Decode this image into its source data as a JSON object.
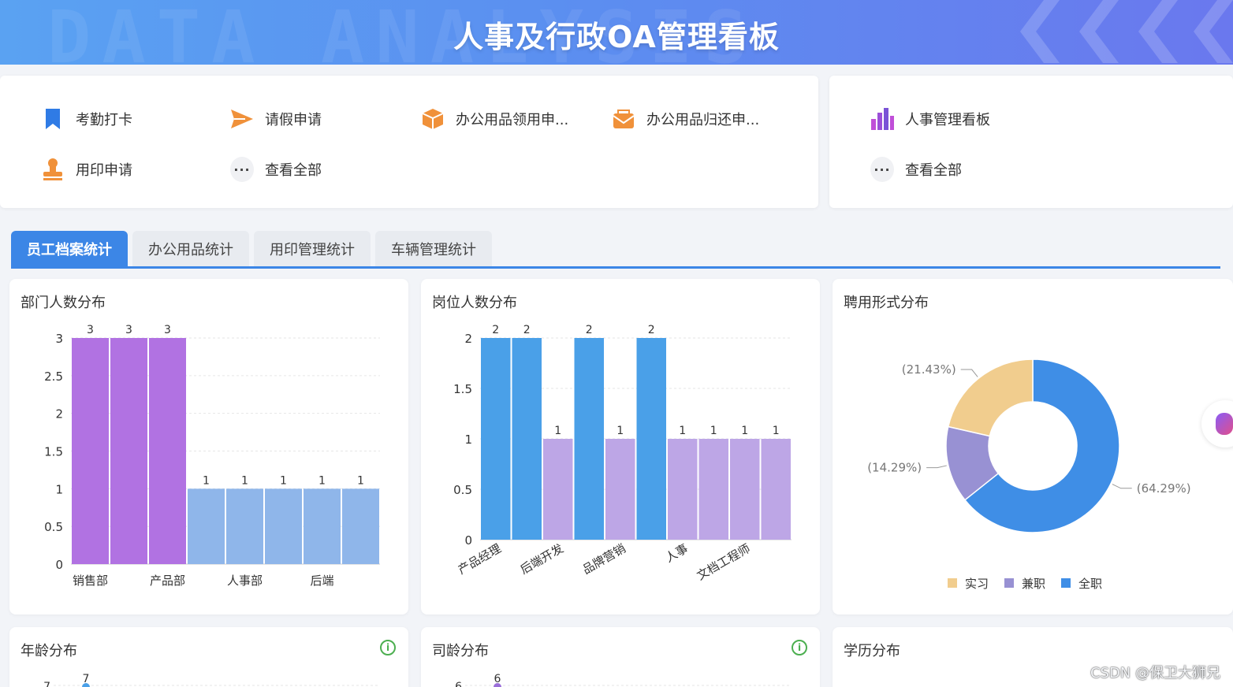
{
  "header": {
    "title": "人事及行政OA管理看板",
    "watermark": "DATA ANALYSIS"
  },
  "quick_left": {
    "items": [
      {
        "label": "考勤打卡",
        "icon": "bookmark-icon",
        "color": "#2f7be5"
      },
      {
        "label": "请假申请",
        "icon": "send-icon",
        "color": "#f0913a"
      },
      {
        "label": "办公用品领用申...",
        "icon": "box-icon",
        "color": "#f0913a"
      },
      {
        "label": "办公用品归还申...",
        "icon": "envelope-icon",
        "color": "#f0913a"
      },
      {
        "label": "用印申请",
        "icon": "stamp-icon",
        "color": "#f0913a"
      },
      {
        "label": "查看全部",
        "icon": "more-icon"
      }
    ]
  },
  "quick_right": {
    "items": [
      {
        "label": "人事管理看板",
        "icon": "bar-chart-icon",
        "color": "#9b4fd8"
      },
      {
        "label": "查看全部",
        "icon": "more-icon"
      }
    ]
  },
  "tabs": [
    {
      "label": "员工档案统计",
      "active": true
    },
    {
      "label": "办公用品统计",
      "active": false
    },
    {
      "label": "用印管理统计",
      "active": false
    },
    {
      "label": "车辆管理统计",
      "active": false
    }
  ],
  "cards": {
    "dept": {
      "title": "部门人数分布"
    },
    "post": {
      "title": "岗位人数分布"
    },
    "hire": {
      "title": "聘用形式分布"
    },
    "age": {
      "title": "年龄分布"
    },
    "tenure": {
      "title": "司龄分布"
    },
    "edu": {
      "title": "学历分布"
    }
  },
  "chart_data": [
    {
      "id": "dept",
      "type": "bar",
      "title": "部门人数分布",
      "categories": [
        "销售部",
        "",
        "产品部",
        "",
        "人事部",
        "",
        "后端",
        ""
      ],
      "values": [
        3,
        3,
        3,
        1,
        1,
        1,
        1,
        1
      ],
      "colors": [
        "#b172e2",
        "#b172e2",
        "#b172e2",
        "#8fb6ea",
        "#8fb6ea",
        "#8fb6ea",
        "#8fb6ea",
        "#8fb6ea"
      ],
      "ylim": [
        0,
        3
      ],
      "yticks": [
        "0",
        "0.5",
        "1",
        "1.5",
        "2",
        "2.5",
        "3"
      ],
      "grid": true
    },
    {
      "id": "post",
      "type": "bar",
      "title": "岗位人数分布",
      "categories": [
        "产品经理",
        "",
        "后端开发",
        "",
        "品牌营销",
        "",
        "人事",
        "",
        "文档工程师",
        ""
      ],
      "values": [
        2,
        2,
        1,
        2,
        1,
        2,
        1,
        1,
        1,
        1
      ],
      "colors": [
        "#4aa0e8",
        "#4aa0e8",
        "#bda6e6",
        "#4aa0e8",
        "#bda6e6",
        "#4aa0e8",
        "#bda6e6",
        "#bda6e6",
        "#bda6e6",
        "#bda6e6"
      ],
      "ylim": [
        0,
        2
      ],
      "yticks": [
        "0",
        "0.5",
        "1",
        "1.5",
        "2"
      ],
      "grid": true
    },
    {
      "id": "hire",
      "type": "pie",
      "title": "聘用形式分布",
      "slices": [
        {
          "name": "实习",
          "value": 21.43,
          "label": "(21.43%)",
          "color": "#f1cd8e"
        },
        {
          "name": "兼职",
          "value": 14.29,
          "label": "(14.29%)",
          "color": "#9891d3"
        },
        {
          "name": "全职",
          "value": 64.29,
          "label": "(64.29%)",
          "color": "#3f8ee6"
        }
      ],
      "legend": "bottom"
    },
    {
      "id": "age",
      "type": "line",
      "title": "年龄分布",
      "y_top_tick": "7",
      "peak_label": "7",
      "color": "#4aa0e8"
    },
    {
      "id": "tenure",
      "type": "line",
      "title": "司龄分布",
      "y_top_tick": "6",
      "peak_label": "6",
      "color": "#9b6fd9"
    }
  ],
  "side_button": {
    "icon": "assistant-icon"
  },
  "watermark_text": "CSDN @保卫大狮兄"
}
